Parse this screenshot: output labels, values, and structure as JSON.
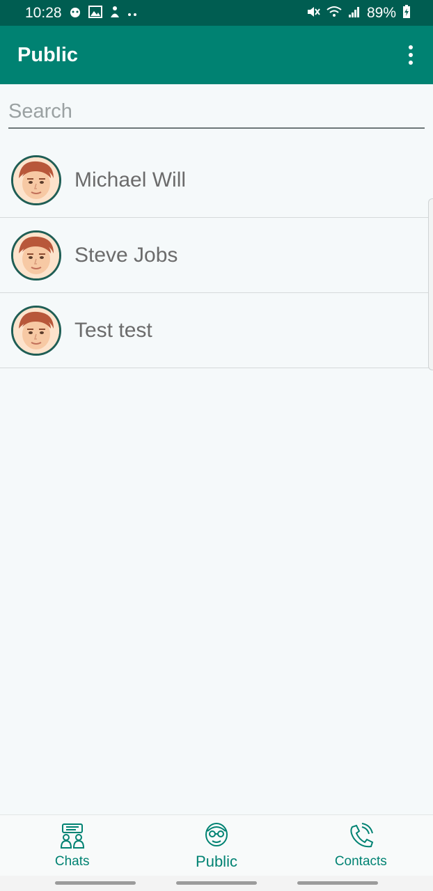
{
  "status": {
    "time": "10:28",
    "battery": "89%"
  },
  "appbar": {
    "title": "Public",
    "menu_icon": "more-vert-icon"
  },
  "search": {
    "placeholder": "Search",
    "value": ""
  },
  "contacts": [
    {
      "name": "Michael Will",
      "avatar": "male-avatar"
    },
    {
      "name": "Steve Jobs",
      "avatar": "male-avatar"
    },
    {
      "name": "Test test",
      "avatar": "male-avatar"
    }
  ],
  "nav": {
    "chats": {
      "label": "Chats",
      "icon": "chats-icon"
    },
    "public": {
      "label": "Public",
      "icon": "public-icon",
      "active": true
    },
    "contacts": {
      "label": "Contacts",
      "icon": "phone-icon"
    }
  },
  "colors": {
    "primary": "#008272",
    "status_bar": "#005d51",
    "background": "#f5f9fa"
  }
}
